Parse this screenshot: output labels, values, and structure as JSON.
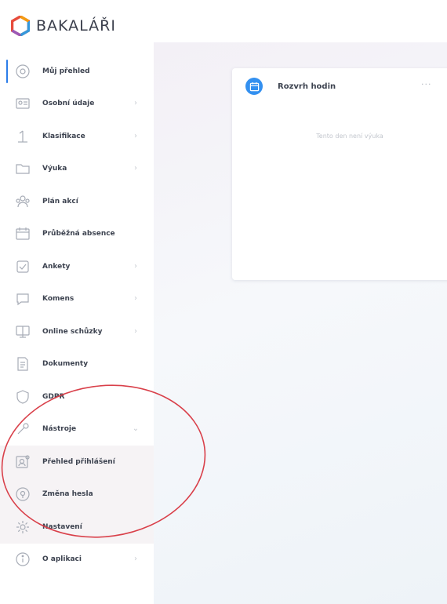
{
  "app": {
    "logo_text": "BAKALÁŘI",
    "accent": "#2b7de9",
    "logo_colors": [
      "#e74c3c",
      "#f39c12",
      "#3498db",
      "#9b59b6"
    ]
  },
  "sidebar": {
    "items": [
      {
        "label": "Můj přehled",
        "icon": "dashboard-icon",
        "chevron": false,
        "active": true
      },
      {
        "label": "Osobní údaje",
        "icon": "user-card-icon",
        "chevron": true
      },
      {
        "label": "Klasifikace",
        "icon": "grade-icon",
        "chevron": true
      },
      {
        "label": "Výuka",
        "icon": "folder-icon",
        "chevron": true
      },
      {
        "label": "Plán akcí",
        "icon": "people-icon",
        "chevron": false
      },
      {
        "label": "Průběžná absence",
        "icon": "calendar-icon",
        "chevron": false
      },
      {
        "label": "Ankety",
        "icon": "checkbox-icon",
        "chevron": true
      },
      {
        "label": "Komens",
        "icon": "message-icon",
        "chevron": true
      },
      {
        "label": "Online schůzky",
        "icon": "monitor-icon",
        "chevron": true
      },
      {
        "label": "Dokumenty",
        "icon": "document-icon",
        "chevron": false
      },
      {
        "label": "GDPR",
        "icon": "shield-icon",
        "chevron": false
      },
      {
        "label": "Nástroje",
        "icon": "tools-icon",
        "chevron": "down"
      },
      {
        "label": "Přehled přihlášení",
        "icon": "login-history-icon",
        "chevron": false,
        "sub": true
      },
      {
        "label": "Změna hesla",
        "icon": "key-icon",
        "chevron": false,
        "sub": true
      },
      {
        "label": "Nastavení",
        "icon": "gear-icon",
        "chevron": false,
        "sub": true
      },
      {
        "label": "O aplikaci",
        "icon": "info-icon",
        "chevron": true
      }
    ]
  },
  "widget": {
    "title": "Rozvrh hodin",
    "menu": "···",
    "empty_text": "Tento den není výuka"
  }
}
